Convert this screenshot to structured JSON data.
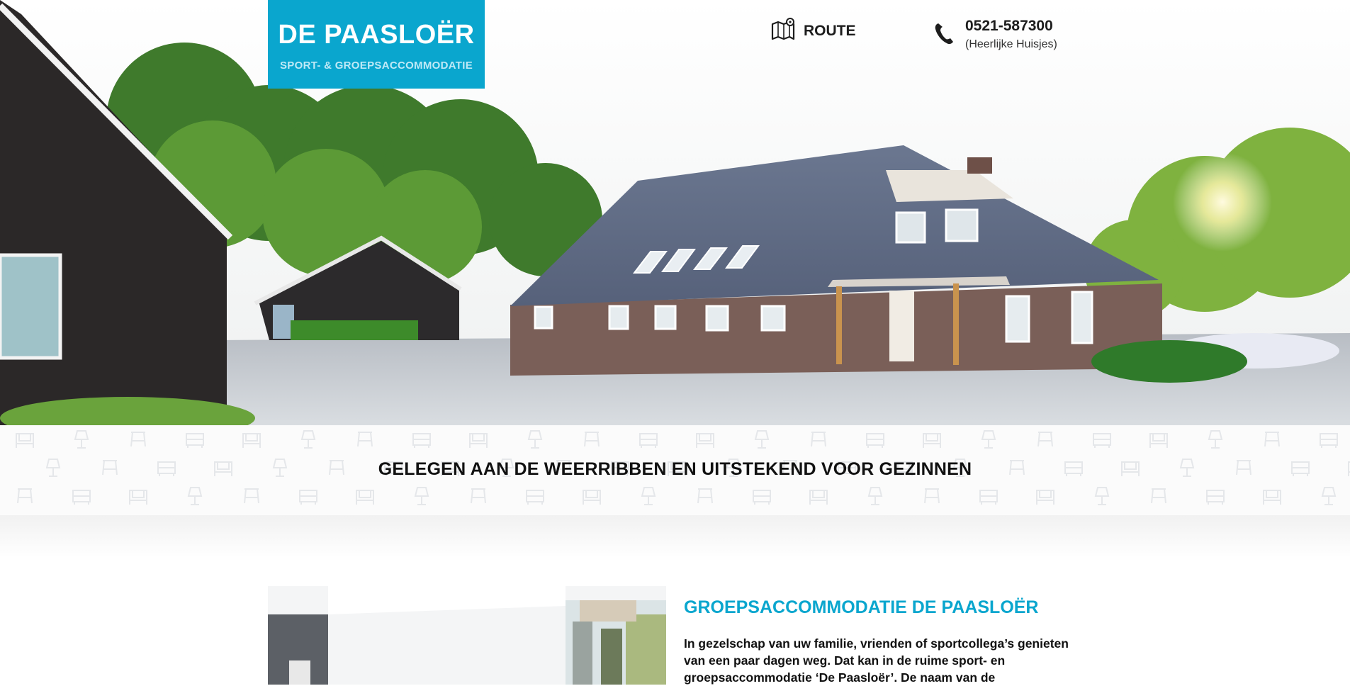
{
  "header": {
    "logo": {
      "title": "DE PAASLOËR",
      "subtitle": "SPORT- & GROEPSACCOMMODATIE"
    },
    "route": {
      "label": "ROUTE",
      "icon": "map-icon"
    },
    "contact": {
      "phone": "0521-587300",
      "note": "(Heerlijke Huisjes)",
      "icon": "phone-icon"
    }
  },
  "tagline": "GELEGEN AAN DE WEERRIBBEN EN UITSTEKEND VOOR GEZINNEN",
  "intro": {
    "heading": "GROEPSACCOMMODATIE DE PAASLOËR",
    "text": "In gezelschap van uw familie, vrienden of sportcollega’s genieten van een paar dagen weg. Dat kan in de ruime sport- en groepsaccommodatie ‘De Paasloër’. De naam van de"
  },
  "colors": {
    "accent": "#0aa6ce",
    "text": "#111111"
  }
}
